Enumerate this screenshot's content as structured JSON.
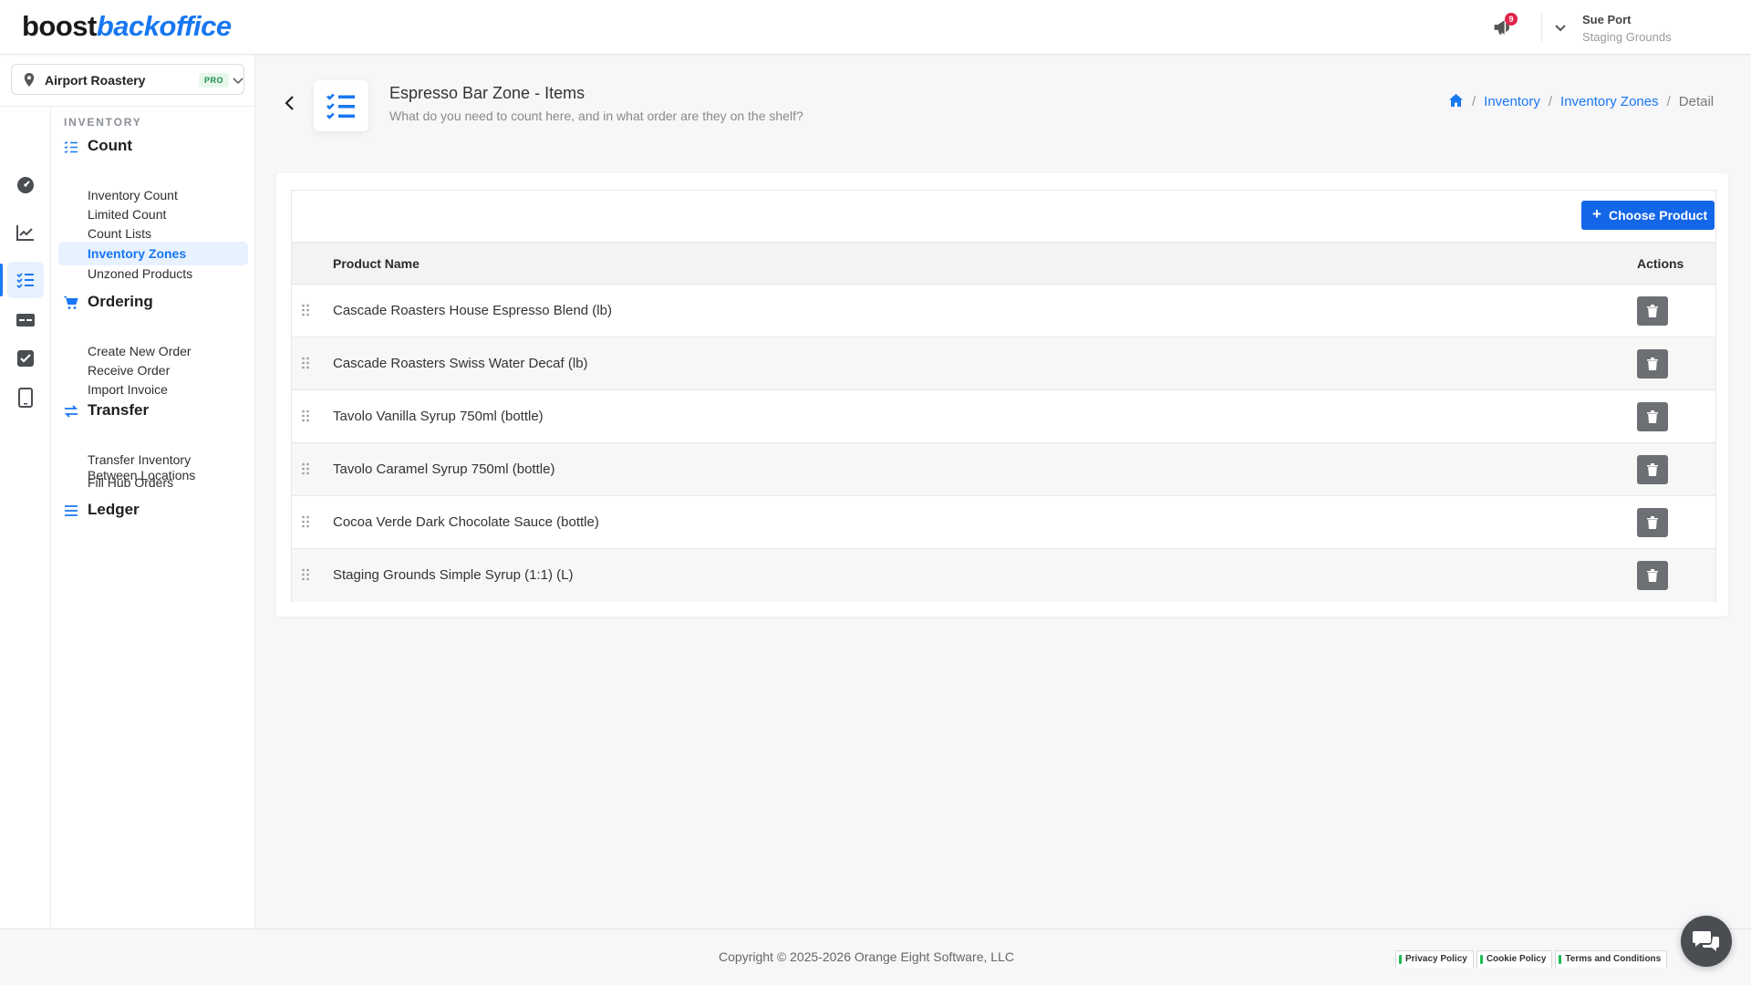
{
  "brand": {
    "part1": "boost",
    "part2": "backoffice",
    "accent": "#1877f2"
  },
  "header": {
    "notification_count": "9",
    "user_name": "Sue Port",
    "user_location": "Staging Grounds"
  },
  "location_selector": {
    "name": "Airport Roastery",
    "badge": "PRO"
  },
  "nav": {
    "category": "INVENTORY",
    "sections": [
      {
        "label": "Count",
        "items": [
          "Inventory Count",
          "Limited Count",
          "Count Lists",
          "Inventory Zones",
          "Unzoned Products"
        ]
      },
      {
        "label": "Ordering",
        "items": [
          "Create New Order",
          "Receive Order",
          "Import Invoice"
        ]
      },
      {
        "label": "Transfer",
        "items": [
          "Transfer Inventory Between Locations",
          "Fill Hub Orders"
        ]
      },
      {
        "label": "Ledger",
        "items": []
      }
    ],
    "active_item": "Inventory Zones"
  },
  "page": {
    "title": "Espresso Bar Zone - Items",
    "subtitle": "What do you need to count here, and in what order are they on the shelf?"
  },
  "breadcrumb": [
    "Inventory",
    "Inventory Zones",
    "Detail"
  ],
  "table": {
    "add_button": "Choose Product",
    "columns": {
      "name": "Product Name",
      "actions": "Actions"
    },
    "rows": [
      "Cascade Roasters House Espresso Blend (lb)",
      "Cascade Roasters Swiss Water Decaf (lb)",
      "Tavolo Vanilla Syrup 750ml (bottle)",
      "Tavolo Caramel Syrup 750ml (bottle)",
      "Cocoa Verde Dark Chocolate Sauce (bottle)",
      "Staging Grounds Simple Syrup (1:1) (L)"
    ]
  },
  "footer": {
    "copyright": "Copyright © 2025-2026 Orange Eight Software, LLC",
    "policies": [
      "Privacy Policy",
      "Cookie Policy",
      "Terms and Conditions"
    ]
  }
}
